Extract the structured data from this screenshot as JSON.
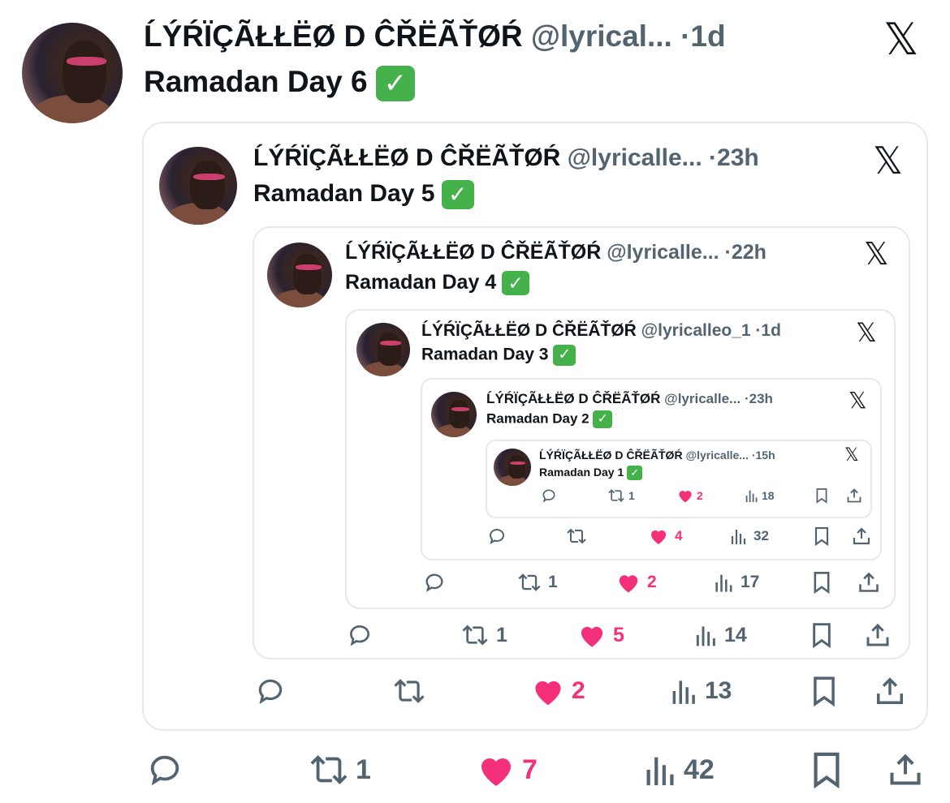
{
  "tweets": [
    {
      "name": "ĹÝŔÏÇÃŁŁËØ D ĈŘËÃŤØŔ",
      "handle": "@lyrical...",
      "dot": "·",
      "time": "1d",
      "text": "Ramadan Day 6",
      "check": "✓",
      "x_icon": "𝕏",
      "actions": {
        "reply": "",
        "retweet": "1",
        "like": "7",
        "views": "42"
      }
    },
    {
      "name": "ĹÝŔÏÇÃŁŁËØ D ĈŘËÃŤØŔ",
      "handle": "@lyricalle...",
      "dot": "·",
      "time": "23h",
      "text": "Ramadan Day 5",
      "check": "✓",
      "x_icon": "𝕏",
      "actions": {
        "reply": "",
        "retweet": "",
        "like": "2",
        "views": "13"
      }
    },
    {
      "name": "ĹÝŔÏÇÃŁŁËØ D ĈŘËÃŤØŔ",
      "handle": "@lyricalle...",
      "dot": "·",
      "time": "22h",
      "text": "Ramadan Day 4",
      "check": "✓",
      "x_icon": "𝕏",
      "actions": {
        "reply": "",
        "retweet": "1",
        "like": "5",
        "views": "14"
      }
    },
    {
      "name": "ĹÝŔÏÇÃŁŁËØ D ĈŘËÃŤØŔ",
      "handle": "@lyricalleo_1",
      "dot": "·",
      "time": "1d",
      "text": "Ramadan Day 3",
      "check": "✓",
      "x_icon": "𝕏",
      "actions": {
        "reply": "",
        "retweet": "1",
        "like": "2",
        "views": "17"
      }
    },
    {
      "name": "ĹÝŔÏÇÃŁŁËØ D ĈŘËÃŤØŔ",
      "handle": "@lyricalle...",
      "dot": "·",
      "time": "23h",
      "text": "Ramadan Day 2",
      "check": "✓",
      "x_icon": "𝕏",
      "actions": {
        "reply": "",
        "retweet": "",
        "like": "4",
        "views": "32"
      }
    },
    {
      "name": "ĹÝŔÏÇÃŁŁËØ D ĈŘËÃŤØŔ",
      "handle": "@lyricalle...",
      "dot": "·",
      "time": "15h",
      "text": "Ramadan Day 1",
      "check": "✓",
      "x_icon": "𝕏",
      "actions": {
        "reply": "",
        "retweet": "1",
        "like": "2",
        "views": "18"
      }
    }
  ],
  "colors": {
    "like": "#f4307a",
    "muted": "#536471",
    "text": "#0f1419",
    "check": "#44b14a",
    "border": "#e6e9ec"
  }
}
